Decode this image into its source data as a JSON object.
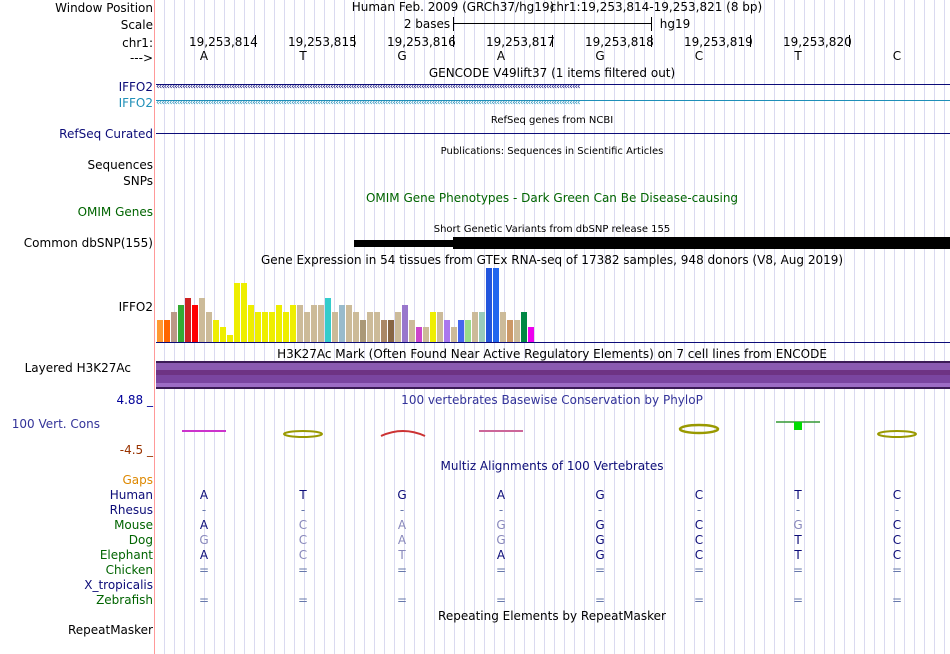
{
  "labels": {
    "window_position": "Window Position",
    "scale": "Scale",
    "chrom": "chr1:",
    "strand_arrow": "--->",
    "iffo2_a": "IFFO2",
    "iffo2_b": "IFFO2",
    "refseq": "RefSeq Curated",
    "sequences": "Sequences",
    "snps": "SNPs",
    "omim": "OMIM Genes",
    "dbsnp": "Common dbSNP(155)",
    "gtex_gene": "IFFO2",
    "h3k27ac": "Layered H3K27Ac",
    "phylo_max": "4.88 _",
    "cons": "100 Vert. Cons",
    "phylo_min": "-4.5 _",
    "gaps": "Gaps",
    "repeatmasker": "RepeatMasker"
  },
  "header": {
    "assembly": "Human Feb. 2009 (GRCh37/hg19)",
    "position": "chr1:19,253,814-19,253,821 (8 bp)",
    "scale_bases": "2 bases",
    "db": "hg19"
  },
  "ruler": [
    "19,253,814",
    "19,253,815",
    "19,253,816",
    "19,253,817",
    "19,253,818",
    "19,253,819",
    "19,253,820"
  ],
  "bases": [
    "A",
    "T",
    "G",
    "A",
    "G",
    "C",
    "T",
    "C"
  ],
  "titles": {
    "gencode": "GENCODE V49lift37 (1 items filtered out)",
    "refseq": "RefSeq genes from NCBI",
    "publications": "Publications: Sequences in Scientific Articles",
    "omim": "OMIM Gene Phenotypes - Dark Green Can Be Disease-causing",
    "dbsnp": "Short Genetic Variants from dbSNP release 155",
    "gtex": "Gene Expression in 54 tissues from GTEx RNA-seq of 17382 samples, 948 donors (V8, Aug 2019)",
    "h3k27ac": "H3K27Ac Mark (Often Found Near Active Regulatory Elements) on 7 cell lines from ENCODE",
    "phylop": "100 vertebrates Basewise Conservation by PhyloP",
    "multiz": "Multiz Alignments of 100 Vertebrates",
    "repeat": "Repeating Elements by RepeatMasker"
  },
  "strand_glyphs": {
    "arrow_row": "‹‹‹‹‹‹‹‹‹‹‹‹‹‹‹‹‹‹‹‹‹‹‹‹‹‹‹‹‹‹‹‹‹‹‹‹‹‹‹‹‹‹‹‹‹‹‹‹‹‹‹‹‹‹‹‹‹‹‹‹‹‹‹‹‹‹‹‹‹‹‹‹‹‹‹‹‹‹‹‹‹‹‹‹‹‹‹‹‹‹‹‹‹‹‹‹‹‹‹‹‹‹‹‹‹‹‹‹‹‹‹‹‹‹‹‹‹‹‹‹‹‹‹‹‹‹‹‹‹‹‹‹‹‹‹‹‹‹‹‹‹‹‹‹‹‹‹‹‹‹‹‹‹‹‹‹‹‹‹‹‹‹‹"
  },
  "gtex_expression": [
    3,
    3,
    4,
    5,
    6,
    5,
    6,
    4,
    3,
    2,
    1,
    8,
    8,
    5,
    4,
    4,
    4,
    5,
    4,
    5,
    5,
    4,
    5,
    5,
    6,
    4,
    5,
    5,
    4,
    3,
    4,
    4,
    3,
    3,
    4,
    5,
    3,
    2,
    2,
    4,
    4,
    3,
    2,
    3,
    3,
    4,
    4,
    10,
    10,
    4,
    3,
    3,
    4,
    2
  ],
  "colors": {
    "gencode": "#0c0c78",
    "gencode_alt": "#0c7890",
    "refseq": "#0c0c78",
    "omim": "#006400",
    "phylo_max": "#000099",
    "phylo_min": "#993300",
    "cons_label": "#333399",
    "gaps": "#dd8800",
    "h3k27ac": "#6e3384"
  },
  "alignment": {
    "species": [
      {
        "name": "Human",
        "color": "#0c0c78",
        "bases": [
          "A",
          "T",
          "G",
          "A",
          "G",
          "C",
          "T",
          "C"
        ]
      },
      {
        "name": "Rhesus",
        "color": "#0c0c78",
        "bases": [
          "-",
          "-",
          "-",
          "-",
          "-",
          "-",
          "-",
          "-"
        ]
      },
      {
        "name": "Mouse",
        "color": "#006400",
        "bases": [
          "A",
          "C",
          "A",
          "G",
          "G",
          "C",
          "G",
          "C"
        ]
      },
      {
        "name": "Dog",
        "color": "#006400",
        "bases": [
          "G",
          "C",
          "A",
          "G",
          "G",
          "C",
          "T",
          "C"
        ]
      },
      {
        "name": "Elephant",
        "color": "#006400",
        "bases": [
          "A",
          "C",
          "T",
          "A",
          "G",
          "C",
          "T",
          "C"
        ]
      },
      {
        "name": "Chicken",
        "color": "#006400",
        "bases": [
          "=",
          "=",
          "=",
          "=",
          "=",
          "=",
          "=",
          "="
        ]
      },
      {
        "name": "X_tropicalis",
        "color": "#0c0c78",
        "bases": [
          "",
          "",
          "",
          "",
          "",
          "",
          "",
          ""
        ]
      },
      {
        "name": "Zebrafish",
        "color": "#006400",
        "bases": [
          "=",
          "=",
          "=",
          "=",
          "=",
          "=",
          "=",
          "="
        ]
      }
    ],
    "match": [
      [
        true,
        true,
        true,
        true,
        true,
        true,
        true,
        true
      ],
      [
        true,
        true,
        true,
        true,
        true,
        true,
        true,
        true
      ],
      [
        true,
        false,
        false,
        false,
        true,
        true,
        false,
        true
      ],
      [
        false,
        false,
        false,
        false,
        true,
        true,
        true,
        true
      ],
      [
        true,
        false,
        false,
        true,
        true,
        true,
        true,
        true
      ],
      [
        true,
        true,
        true,
        true,
        true,
        true,
        true,
        true
      ],
      [
        true,
        true,
        true,
        true,
        true,
        true,
        true,
        true
      ],
      [
        true,
        true,
        true,
        true,
        true,
        true,
        true,
        true
      ]
    ]
  }
}
